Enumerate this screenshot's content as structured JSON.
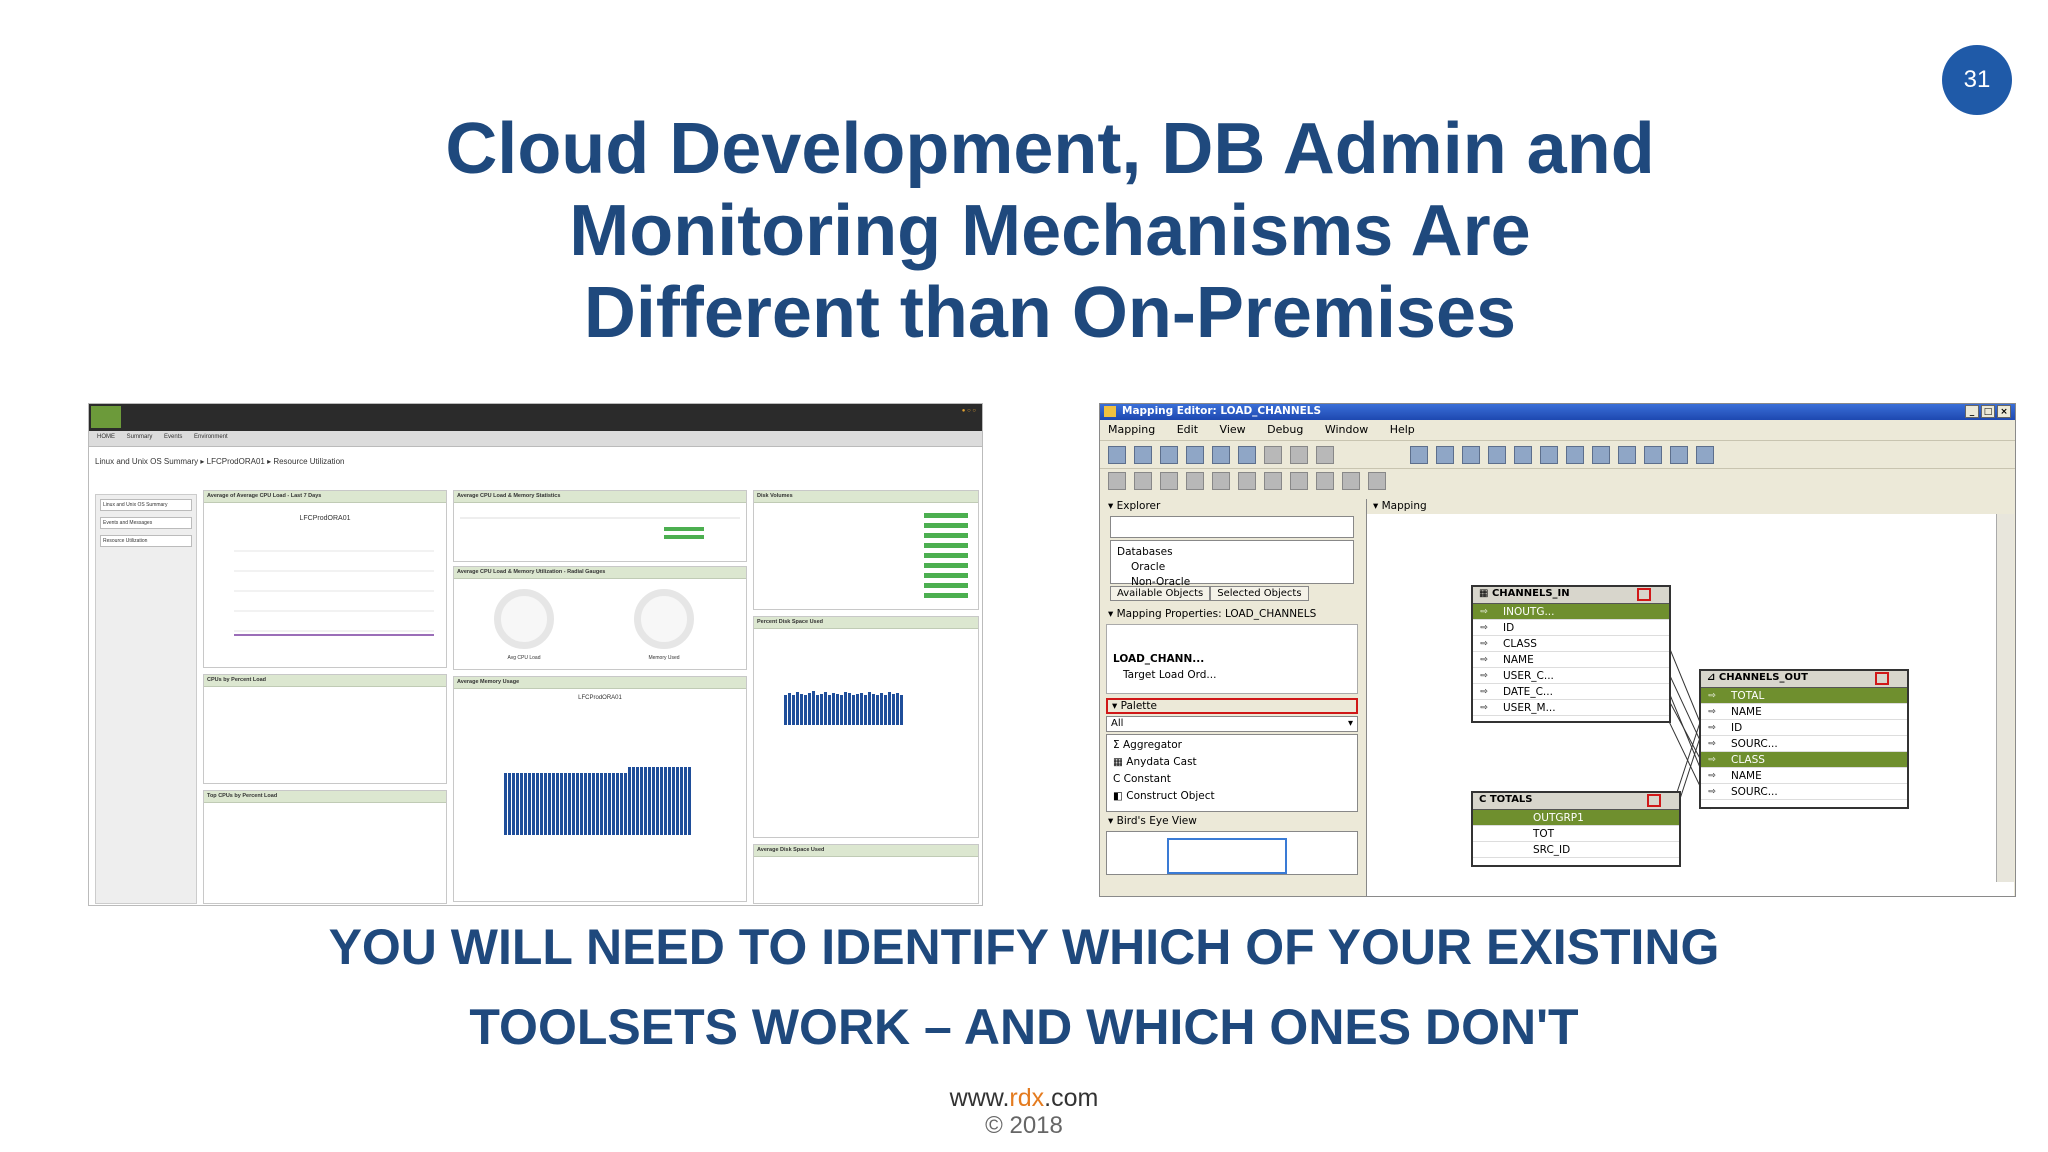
{
  "slide": {
    "number": "31",
    "title_lines": [
      "Cloud Development, DB Admin and",
      "Monitoring Mechanisms Are",
      "Different than On-Premises"
    ],
    "subtitle_lines": [
      "YOU WILL NEED TO IDENTIFY WHICH OF YOUR EXISTING",
      "TOOLSETS WORK – AND WHICH ONES DON'T"
    ],
    "footer": {
      "url_prefix": "www.",
      "url_highlight": "rdx",
      "url_suffix": ".com",
      "copyright": "© 2018"
    }
  },
  "dashboard": {
    "nav": [
      "HOME",
      "Summary",
      "Events",
      "Environment"
    ],
    "breadcrumb": "Linux and Unix OS Summary ▸ LFCProdORA01 ▸ Resource Utilization",
    "sidebar": [
      "Linux and Unix OS Summary",
      "Events and Messages",
      "Resource Utilization"
    ],
    "panels": {
      "cpu_load": "Average of Average CPU Load - Last 7 Days",
      "cpu_memory_stats": "Average CPU Load & Memory Statistics",
      "disk_volumes": "Disk Volumes",
      "radial_gauges": "Average CPU Load & Memory Utilization - Radial Gauges",
      "percent_disk": "Percent Disk Space Used",
      "cpus_by_load": "CPUs by Percent Load",
      "memory_usage": "Average Memory Usage",
      "top_cpus": "Top CPUs by Percent Load",
      "avg_disk": "Average Disk Space Used"
    },
    "host": "LFCProdORA01",
    "gauges": [
      "Avg CPU Load",
      "Memory Used"
    ]
  },
  "mapping_editor": {
    "window_title": "Mapping Editor: LOAD_CHANNELS",
    "window_controls": [
      "_",
      "□",
      "×"
    ],
    "menu": [
      "Mapping",
      "Edit",
      "View",
      "Debug",
      "Window",
      "Help"
    ],
    "explorer": {
      "label": "Explorer",
      "tree": [
        "Databases",
        "Oracle",
        "Non-Oracle"
      ],
      "tabs": [
        "Available Objects",
        "Selected Objects"
      ]
    },
    "properties": {
      "label": "Mapping Properties: LOAD_CHANNELS",
      "object": "LOAD_CHANN...",
      "field": "Target Load Ord..."
    },
    "palette": {
      "label": "Palette",
      "filter": "All",
      "items": [
        "Aggregator",
        "Anydata Cast",
        "Constant",
        "Construct Object"
      ]
    },
    "birds_eye": "Bird's Eye View",
    "canvas_label": "Mapping",
    "tables": {
      "channels_in": {
        "name": "CHANNELS_IN",
        "group": "INOUTG...",
        "rows": [
          "ID",
          "CLASS",
          "NAME",
          "USER_C...",
          "DATE_C...",
          "USER_M..."
        ]
      },
      "totals": {
        "name": "TOTALS",
        "group": "OUTGRP1",
        "rows": [
          "TOT",
          "SRC_ID"
        ]
      },
      "channels_out": {
        "name": "CHANNELS_OUT",
        "group1": "TOTAL",
        "rows1": [
          "NAME",
          "ID",
          "SOURC..."
        ],
        "group2": "CLASS",
        "rows2": [
          "NAME",
          "SOURC..."
        ]
      }
    }
  }
}
